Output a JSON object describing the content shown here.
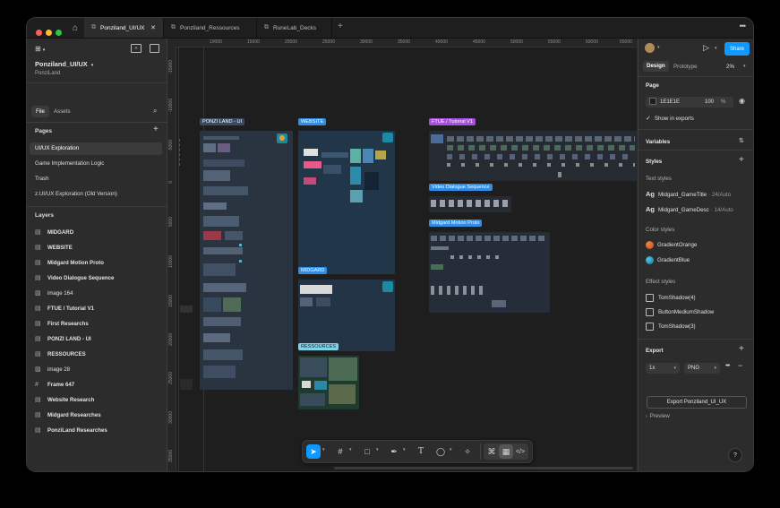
{
  "tabs": {
    "active": "Ponziland_UI/UX",
    "second": "Ponziland_Ressources",
    "third": "RuneLab_Decks"
  },
  "file": {
    "name": "Ponziland_UI/UX",
    "team": "PonziLand"
  },
  "left_tabs": {
    "file": "File",
    "assets": "Assets"
  },
  "pages": {
    "title": "Pages",
    "items": [
      "UI/UX Exploration",
      "Game Implementation Logic",
      "Trash",
      "z.UI/UX Exploration (Old Version)"
    ]
  },
  "layers": {
    "title": "Layers",
    "items": [
      "MIDGARD",
      "WEBSITE",
      "Midgard Motion Proto",
      "Video Dialogue Sequence",
      "image 164",
      "FTUE / Tutorial V1",
      "First Researchs",
      "PONZI LAND - UI",
      "RESSOURCES",
      "image 28",
      "Frame 647",
      "Website Research",
      "Midgard Researches",
      "PonziLand Researches"
    ]
  },
  "ruler": {
    "top": [
      "10000",
      "15000",
      "20000",
      "25000",
      "30000",
      "35000",
      "40000",
      "45000",
      "50000",
      "55000",
      "60000",
      "65000",
      "70000"
    ],
    "left": [
      "-15000",
      "-10000",
      "-5000",
      "0",
      "5000",
      "10000",
      "15000",
      "20000",
      "25000",
      "30000",
      "35000"
    ]
  },
  "frames": {
    "ponzi": "PONZI LAND - UI",
    "website": "WEBSITE",
    "midgard": "MIDGARD",
    "ressources": "RESSOURCES",
    "ftue": "FTUE / Tutorial V1",
    "video": "Video Dialogue Sequence",
    "motion": "Midgard Motion Proto"
  },
  "right": {
    "share": "Share",
    "design": "Design",
    "prototype": "Prototype",
    "zoom": "2%",
    "page_title": "Page",
    "page_color": "1E1E1E",
    "page_opacity": "100",
    "percent": "%",
    "show_exports": "Show in exports",
    "variables": "Variables",
    "styles": "Styles",
    "text_styles": "Text styles",
    "text_style_1": "Midgard_GameTitle",
    "text_style_1_meta": "· 24/Auto",
    "text_style_2": "Midgard_GameDesc",
    "text_style_2_meta": "· 14/Auto",
    "ag": "Ag",
    "color_styles": "Color styles",
    "color_1": "GradientOrange",
    "color_2": "GradientBlue",
    "effect_styles": "Effect styles",
    "effect_1": "TomShadow(4)",
    "effect_2": "ButtonMediumShadow",
    "effect_3": "TomShadow(3)",
    "export": "Export",
    "scale": "1x",
    "format": "PNG",
    "export_button": "Export Ponziland_UI_UX",
    "preview": "Preview"
  },
  "colors": {
    "accent": "#0d99ff",
    "ponzi_label": "#3b4a63",
    "website_label": "#2f8fe8",
    "ftue_label": "#a64fe0",
    "ressources_label": "#7fd3e6"
  }
}
